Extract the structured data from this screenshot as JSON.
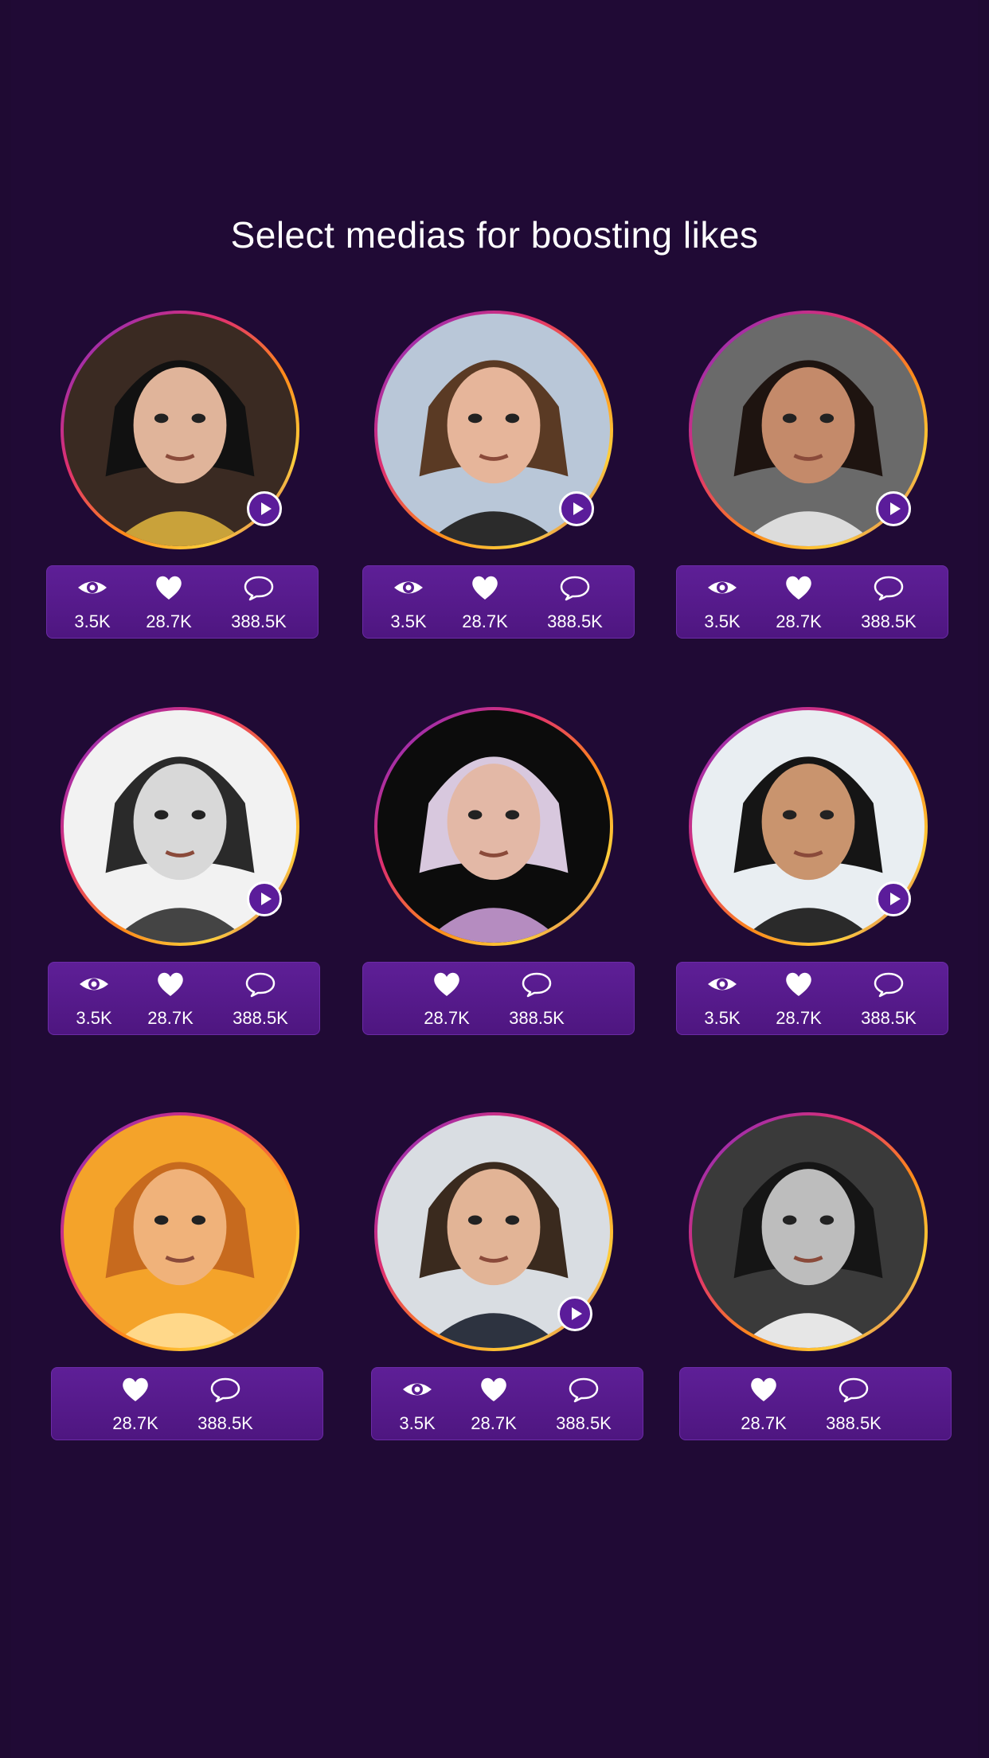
{
  "title": "Select medias for boosting likes",
  "colors": {
    "background": "#200a35",
    "card": "#5a1c92",
    "ring": "#ff8a1a",
    "play": "#5b1c9a"
  },
  "media": [
    {
      "id": "m1",
      "views": "3.5K",
      "likes": "28.7K",
      "comments": "388.5K",
      "has_video": true
    },
    {
      "id": "m2",
      "views": "3.5K",
      "likes": "28.7K",
      "comments": "388.5K",
      "has_video": true
    },
    {
      "id": "m3",
      "views": "3.5K",
      "likes": "28.7K",
      "comments": "388.5K",
      "has_video": true
    },
    {
      "id": "m4",
      "views": "3.5K",
      "likes": "28.7K",
      "comments": "388.5K",
      "has_video": true
    },
    {
      "id": "m5",
      "likes": "28.7K",
      "comments": "388.5K",
      "has_video": false
    },
    {
      "id": "m6",
      "views": "3.5K",
      "likes": "28.7K",
      "comments": "388.5K",
      "has_video": true
    },
    {
      "id": "m7",
      "likes": "28.7K",
      "comments": "388.5K",
      "has_video": false
    },
    {
      "id": "m8",
      "views": "3.5K",
      "likes": "28.7K",
      "comments": "388.5K",
      "has_video": true
    },
    {
      "id": "m9",
      "likes": "28.7K",
      "comments": "388.5K",
      "has_video": false
    }
  ],
  "icons": {
    "views": "eye-icon",
    "likes": "heart-icon",
    "comments": "comment-icon",
    "play": "play-icon"
  }
}
